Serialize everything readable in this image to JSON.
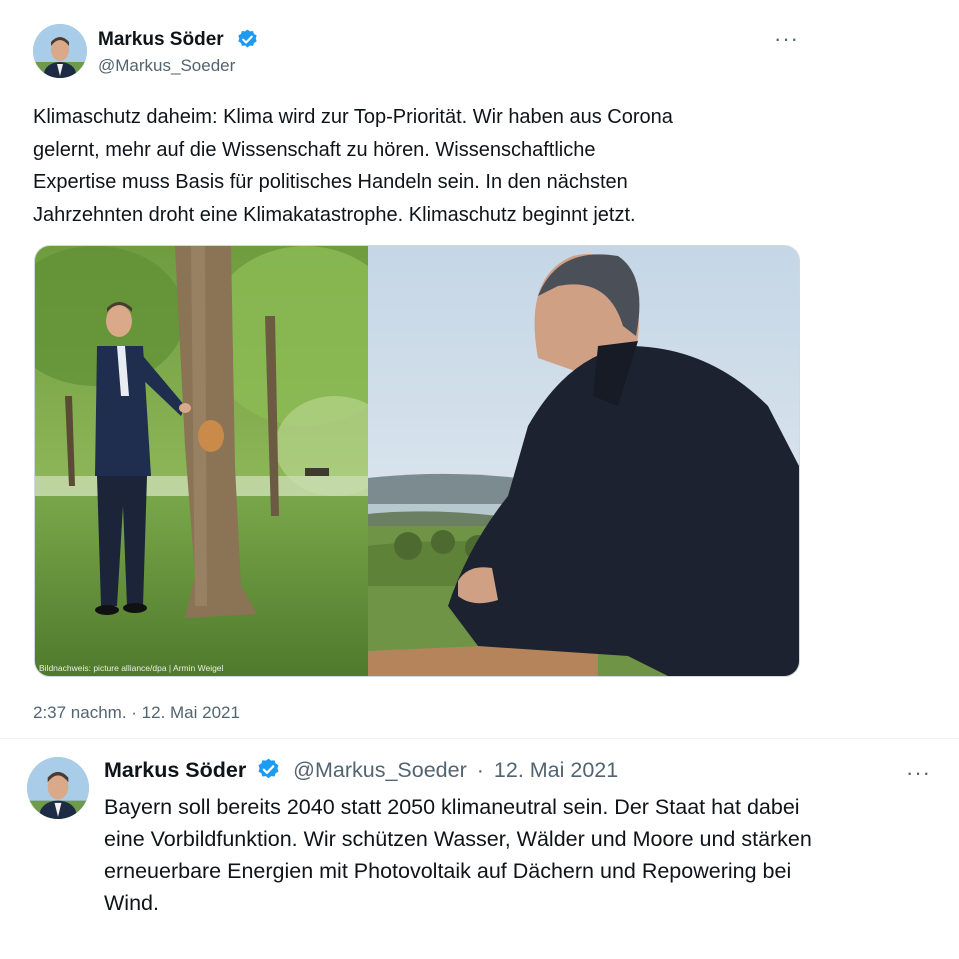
{
  "tweet": {
    "author_name": "Markus Söder",
    "author_handle": "@Markus_Soeder",
    "more_label": "···",
    "text_lines": [
      "Klimaschutz daheim: Klima wird zur Top-Priorität. Wir haben aus Corona",
      "gelernt, mehr auf die Wissenschaft zu hören. Wissenschaftliche",
      "Expertise muss Basis für politisches Handeln sein. In den nächsten",
      "Jahrzehnten droht eine Klimakatastrophe. Klimaschutz beginnt jetzt."
    ],
    "photo_credit": "Bildnachweis: picture alliance/dpa | Armin Weigel",
    "timestamp": "2:37 nachm. · 12. Mai 2021"
  },
  "reply": {
    "author_name": "Markus Söder",
    "author_handle": "@Markus_Soeder",
    "separator": "·",
    "date": "12. Mai 2021",
    "more_label": "···",
    "text_lines": [
      "Bayern soll bereits 2040 statt 2050 klimaneutral sein. Der Staat hat dabei",
      "eine Vorbildfunktion. Wir schützen Wasser, Wälder und Moore und stärken",
      "erneuerbare Energien mit Photovoltaik auf Dächern und Repowering bei",
      "Wind."
    ]
  },
  "icons": {
    "verified": "verified-badge-icon",
    "more": "more-options-icon"
  },
  "colors": {
    "verified_blue": "#1d9bf0",
    "secondary_text": "#536471",
    "primary_text": "#0f1419"
  }
}
